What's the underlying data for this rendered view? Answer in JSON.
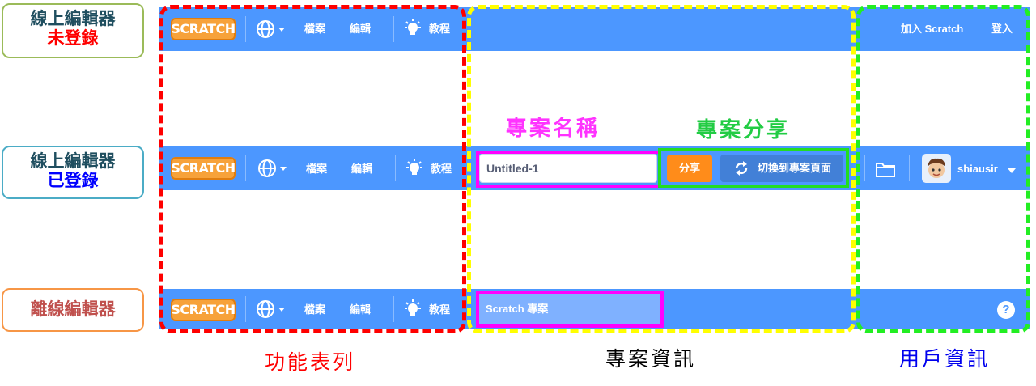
{
  "labels": {
    "online_guest": {
      "line1": "線上編輯器",
      "line2": "未登錄"
    },
    "online_logged": {
      "line1": "線上編輯器",
      "line2": "已登錄"
    },
    "offline": {
      "line1": "離線編輯器"
    }
  },
  "menubar": {
    "logo": "SCRATCH",
    "file": "檔案",
    "edit": "編輯",
    "tutorials": "教程"
  },
  "guest": {
    "join": "加入 Scratch",
    "signin": "登入"
  },
  "logged": {
    "project_title": "Untitled-1",
    "share": "分享",
    "see_project_page": "切換到專案頁面",
    "username": "shiausir"
  },
  "offline": {
    "project_title": "Scratch 專案",
    "help": "?"
  },
  "annotations": {
    "project_name": "專案名稱",
    "project_share": "專案分享"
  },
  "captions": {
    "menu": "功能表列",
    "project_info": "專案資訊",
    "user_info": "用戶資訊"
  },
  "colors": {
    "menu_blue": "#4c97ff",
    "share_orange": "#ff8c1a",
    "red_dash": "#ff0000",
    "yellow_dash": "#ffff00",
    "green_dash": "#22ee22",
    "magenta": "#ff00ff",
    "green_box": "#22dd22"
  }
}
